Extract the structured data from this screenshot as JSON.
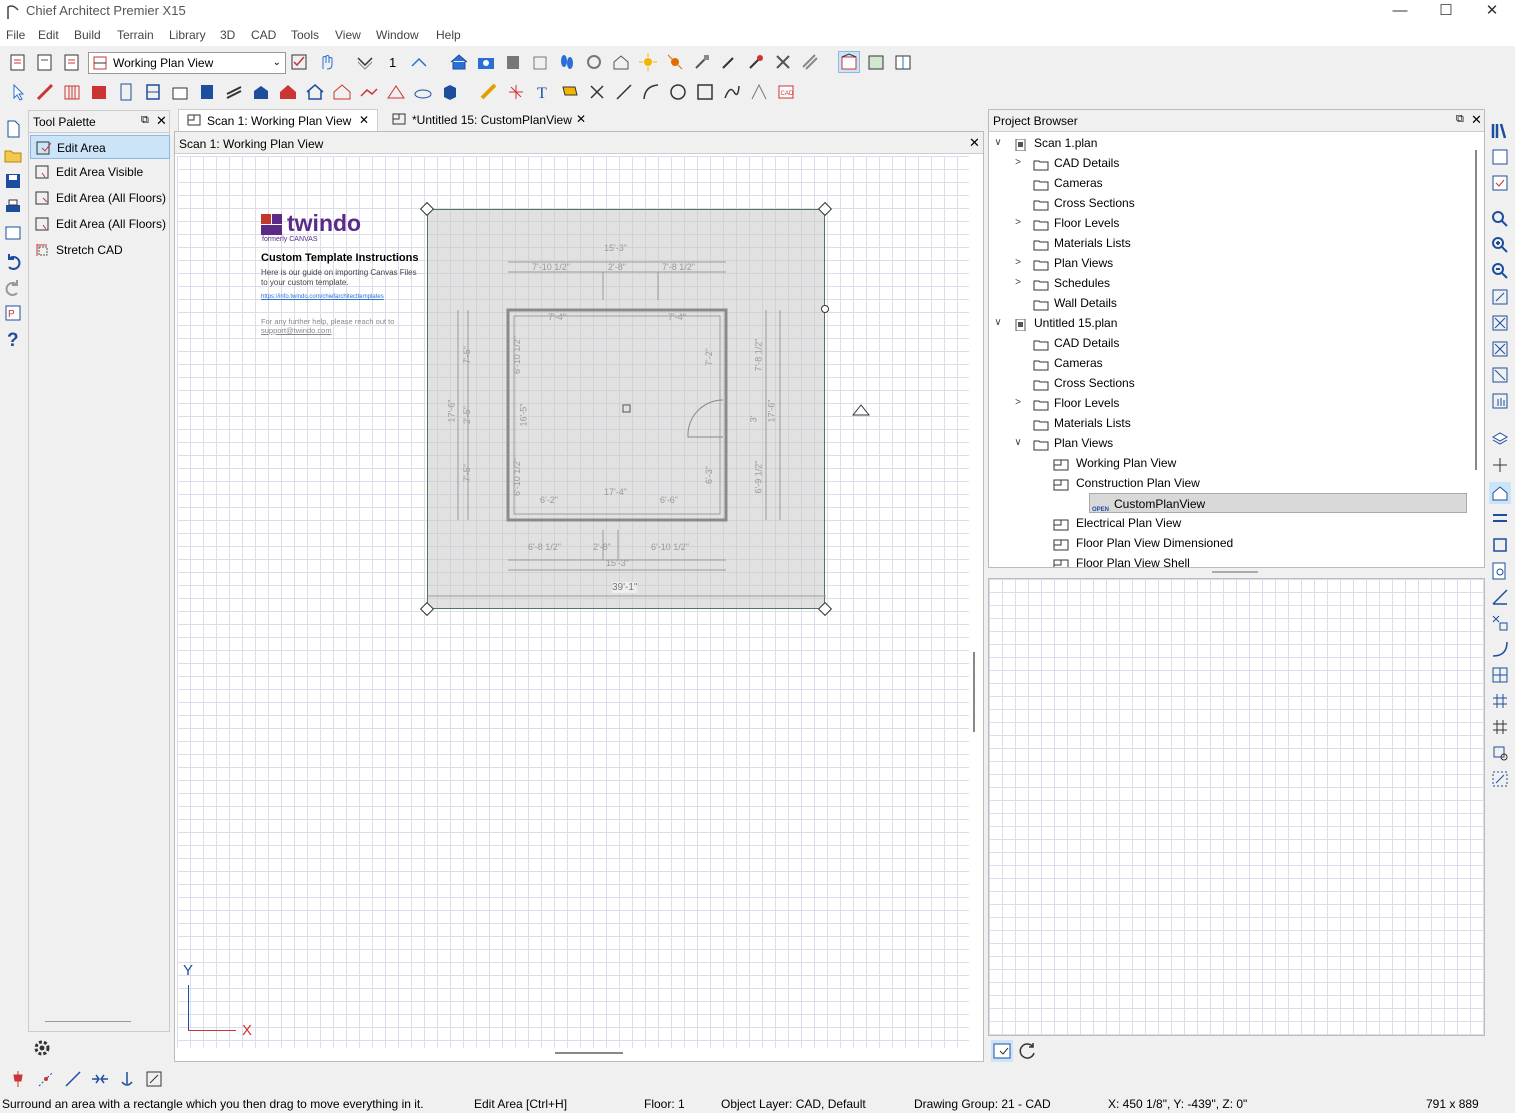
{
  "app": {
    "title": "Chief Architect Premier X15"
  },
  "window_controls": {
    "minimize": "—",
    "maximize": "☐",
    "close": "✕"
  },
  "menu": [
    "File",
    "Edit",
    "Build",
    "Terrain",
    "Library",
    "3D",
    "CAD",
    "Tools",
    "View",
    "Window",
    "Help"
  ],
  "toolbar": {
    "view_combo": "Working Plan View",
    "floor_number": "1"
  },
  "tool_palette": {
    "title": "Tool Palette",
    "items": [
      "Edit Area",
      "Edit Area Visible",
      "Edit Area (All Floors)",
      "Edit Area (All Floors) V",
      "Stretch CAD"
    ]
  },
  "tabs": [
    {
      "label": "Scan 1:  Working Plan View",
      "close": "✕"
    },
    {
      "label": "*Untitled 15: CustomPlanView",
      "close": "✕"
    }
  ],
  "drawing": {
    "title": "Scan 1:  Working Plan View",
    "close": "✕",
    "logo_text": "twindo",
    "logo_sub": "formerly  CANVAS",
    "instructions_title": "Custom Template Instructions",
    "instructions_body1": "Here is our guide on importing Canvas Files",
    "instructions_body2": "to your custom template.",
    "instructions_link": "https://info.twindo.com/chiefarchitecttemplates",
    "help1": "For any further help, please reach out to",
    "help2": "support@twindo.com",
    "dims": {
      "top_total": "15'-3\"",
      "top_a": "7'-10 1/2\"",
      "top_b": "2'-8\"",
      "top_c": "7'-8 1/2\"",
      "inner_top_a": "7'-4\"",
      "inner_top_b": "7'-4\"",
      "left_total": "17'-6\"",
      "left_a": "7'-5\"",
      "left_b": "2'-5\"",
      "left_c": "7'-5\"",
      "left_inner_a": "6'-10 1/2\"",
      "left_inner_b": "16'-5\"",
      "left_inner_c": "6'-10 1/2\"",
      "right_total": "17'-6\"",
      "right_a": "7'-8 1/2\"",
      "right_b": "3'",
      "right_c": "6'-9 1/2\"",
      "right_inner_a": "7'-2\"",
      "right_inner_b": "6'-3\"",
      "inner_bottom_a": "6'-2\"",
      "inner_bottom_mid": "17'-4\"",
      "inner_bottom_b": "6'-6\"",
      "bottom_a": "6'-8 1/2\"",
      "bottom_b": "2'-8\"",
      "bottom_c": "6'-10 1/2\"",
      "bottom_total": "15'-3\"",
      "outer_bottom": "39'-1\""
    },
    "axis_y": "Y",
    "axis_x": "X"
  },
  "project_browser": {
    "title": "Project Browser",
    "rows": [
      {
        "level": 0,
        "label": "Scan 1.plan",
        "arrow": "∨",
        "icon": "plan"
      },
      {
        "level": 1,
        "label": "CAD Details",
        "arrow": ">",
        "icon": "folder"
      },
      {
        "level": 1,
        "label": "Cameras",
        "arrow": "",
        "icon": "folder"
      },
      {
        "level": 1,
        "label": "Cross Sections",
        "arrow": "",
        "icon": "folder"
      },
      {
        "level": 1,
        "label": "Floor Levels",
        "arrow": ">",
        "icon": "folder"
      },
      {
        "level": 1,
        "label": "Materials Lists",
        "arrow": "",
        "icon": "folder"
      },
      {
        "level": 1,
        "label": "Plan Views",
        "arrow": ">",
        "icon": "folder"
      },
      {
        "level": 1,
        "label": "Schedules",
        "arrow": ">",
        "icon": "folder"
      },
      {
        "level": 1,
        "label": "Wall Details",
        "arrow": "",
        "icon": "folder"
      },
      {
        "level": 0,
        "label": "Untitled 15.plan",
        "arrow": "∨",
        "icon": "plan"
      },
      {
        "level": 1,
        "label": "CAD Details",
        "arrow": "",
        "icon": "folder"
      },
      {
        "level": 1,
        "label": "Cameras",
        "arrow": "",
        "icon": "folder"
      },
      {
        "level": 1,
        "label": "Cross Sections",
        "arrow": "",
        "icon": "folder"
      },
      {
        "level": 1,
        "label": "Floor Levels",
        "arrow": ">",
        "icon": "folder"
      },
      {
        "level": 1,
        "label": "Materials Lists",
        "arrow": "",
        "icon": "folder"
      },
      {
        "level": 1,
        "label": "Plan Views",
        "arrow": "∨",
        "icon": "folder"
      },
      {
        "level": 2,
        "label": "Working Plan View",
        "arrow": "",
        "icon": "view"
      },
      {
        "level": 2,
        "label": "Construction Plan View",
        "arrow": "",
        "icon": "view"
      },
      {
        "level": 2,
        "label": "CustomPlanView",
        "arrow": "",
        "icon": "open",
        "selected": true
      },
      {
        "level": 2,
        "label": "Electrical Plan View",
        "arrow": "",
        "icon": "view"
      },
      {
        "level": 2,
        "label": "Floor Plan View Dimensioned",
        "arrow": "",
        "icon": "view"
      },
      {
        "level": 2,
        "label": "Floor Plan View Shell",
        "arrow": "",
        "icon": "view"
      }
    ],
    "open_badge": "OPEN"
  },
  "status": {
    "hint": "Surround an area with a rectangle which you then drag to move everything in it.",
    "tool": "Edit Area [Ctrl+H]",
    "floor": "Floor: 1",
    "layer": "Object Layer: CAD,  Default",
    "group": "Drawing Group: 21 - CAD",
    "coords": "X: 450 1/8\", Y: -439\", Z: 0\"",
    "size": "791 x 889"
  },
  "colors": {
    "accent": "#2a6fd6",
    "selection": "#cce4f7",
    "selected_row": "#d9d9d9",
    "logo": "#5b2a86"
  }
}
